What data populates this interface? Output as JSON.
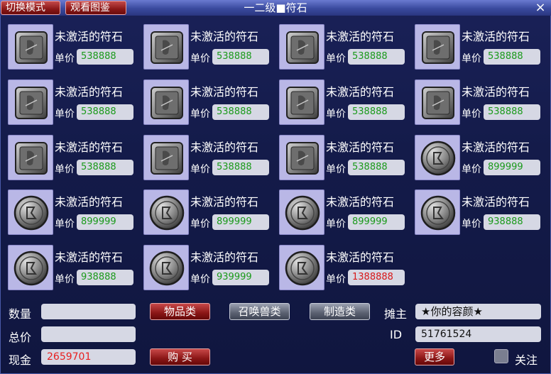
{
  "header": {
    "switch_mode_label": "切换模式",
    "view_catalog_label": "观看图鉴",
    "title": "一二级■符石",
    "close_icon": "×"
  },
  "price_label": "单价",
  "items": [
    {
      "name": "未激活的符石",
      "price": "538888",
      "icon": "square-stone",
      "color": "#1a9a1a"
    },
    {
      "name": "未激活的符石",
      "price": "538888",
      "icon": "square-stone",
      "color": "#1a9a1a"
    },
    {
      "name": "未激活的符石",
      "price": "538888",
      "icon": "square-stone",
      "color": "#1a9a1a"
    },
    {
      "name": "未激活的符石",
      "price": "538888",
      "icon": "square-stone",
      "color": "#1a9a1a"
    },
    {
      "name": "未激活的符石",
      "price": "538888",
      "icon": "square-stone",
      "color": "#1a9a1a"
    },
    {
      "name": "未激活的符石",
      "price": "538888",
      "icon": "square-stone",
      "color": "#1a9a1a"
    },
    {
      "name": "未激活的符石",
      "price": "538888",
      "icon": "square-stone",
      "color": "#1a9a1a"
    },
    {
      "name": "未激活的符石",
      "price": "538888",
      "icon": "square-stone",
      "color": "#1a9a1a"
    },
    {
      "name": "未激活的符石",
      "price": "538888",
      "icon": "square-stone",
      "color": "#1a9a1a"
    },
    {
      "name": "未激活的符石",
      "price": "538888",
      "icon": "square-stone",
      "color": "#1a9a1a"
    },
    {
      "name": "未激活的符石",
      "price": "538888",
      "icon": "square-stone",
      "color": "#1a9a1a"
    },
    {
      "name": "未激活的符石",
      "price": "899999",
      "icon": "round-stone",
      "color": "#1a9a1a"
    },
    {
      "name": "未激活的符石",
      "price": "899999",
      "icon": "round-stone",
      "color": "#1a9a1a"
    },
    {
      "name": "未激活的符石",
      "price": "899999",
      "icon": "round-stone",
      "color": "#1a9a1a"
    },
    {
      "name": "未激活的符石",
      "price": "899999",
      "icon": "round-stone",
      "color": "#1a9a1a"
    },
    {
      "name": "未激活的符石",
      "price": "938888",
      "icon": "round-stone",
      "color": "#1a9a1a"
    },
    {
      "name": "未激活的符石",
      "price": "938888",
      "icon": "round-stone",
      "color": "#1a9a1a"
    },
    {
      "name": "未激活的符石",
      "price": "939999",
      "icon": "round-stone",
      "color": "#1a9a1a"
    },
    {
      "name": "未激活的符石",
      "price": "1388888",
      "icon": "round-stone",
      "color": "#d81818"
    }
  ],
  "bottom": {
    "quantity_label": "数量",
    "quantity_value": "",
    "total_label": "总价",
    "total_value": "",
    "cash_label": "现金",
    "cash_value": "2659701",
    "tab_items_label": "物品类",
    "tab_summon_label": "召唤兽类",
    "tab_craft_label": "制造类",
    "buy_label": "购 买",
    "owner_label": "摊主",
    "owner_value": "★你的容颜★",
    "id_label": "ID",
    "id_value": "51761524",
    "more_label": "更多",
    "follow_label": "关注"
  },
  "colors": {
    "price_green": "#1a9a1a",
    "price_red": "#d81818",
    "cash_red": "#e82020"
  }
}
